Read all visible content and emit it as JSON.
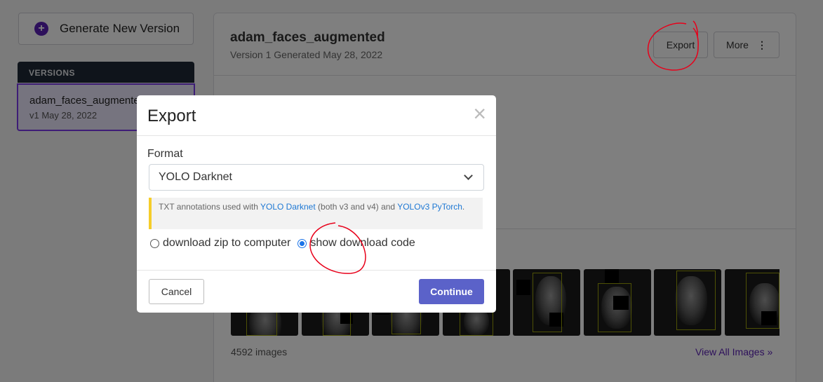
{
  "sidebar": {
    "generate_label": "Generate New Version",
    "versions_heading": "VERSIONS",
    "versions": [
      {
        "name": "adam_faces_augmented",
        "date": "v1 May 28, 2022"
      }
    ]
  },
  "dataset": {
    "title": "adam_faces_augmented",
    "subtitle": "Version 1 Generated May 28, 2022",
    "export_label": "Export",
    "more_label": "More",
    "image_count": "4592 images",
    "view_all_label": "View All Images »"
  },
  "modal": {
    "title": "Export",
    "close_glyph": "×",
    "format_label": "Format",
    "format_value": "YOLO Darknet",
    "info": {
      "prefix": "TXT annotations used with ",
      "link1": "YOLO Darknet",
      "middle": " (both v3 and v4) and ",
      "link2": "YOLOv3 PyTorch",
      "suffix": "."
    },
    "radio_options": [
      {
        "label": "download zip to computer",
        "selected": false
      },
      {
        "label": "show download code",
        "selected": true
      }
    ],
    "cancel_label": "Cancel",
    "continue_label": "Continue"
  },
  "colors": {
    "accent_purple": "#5b21b6",
    "continue_button": "#5b62c9",
    "link_blue": "#1e78d4",
    "info_border": "#f5cd2a",
    "annotation_red": "#e8001a"
  }
}
